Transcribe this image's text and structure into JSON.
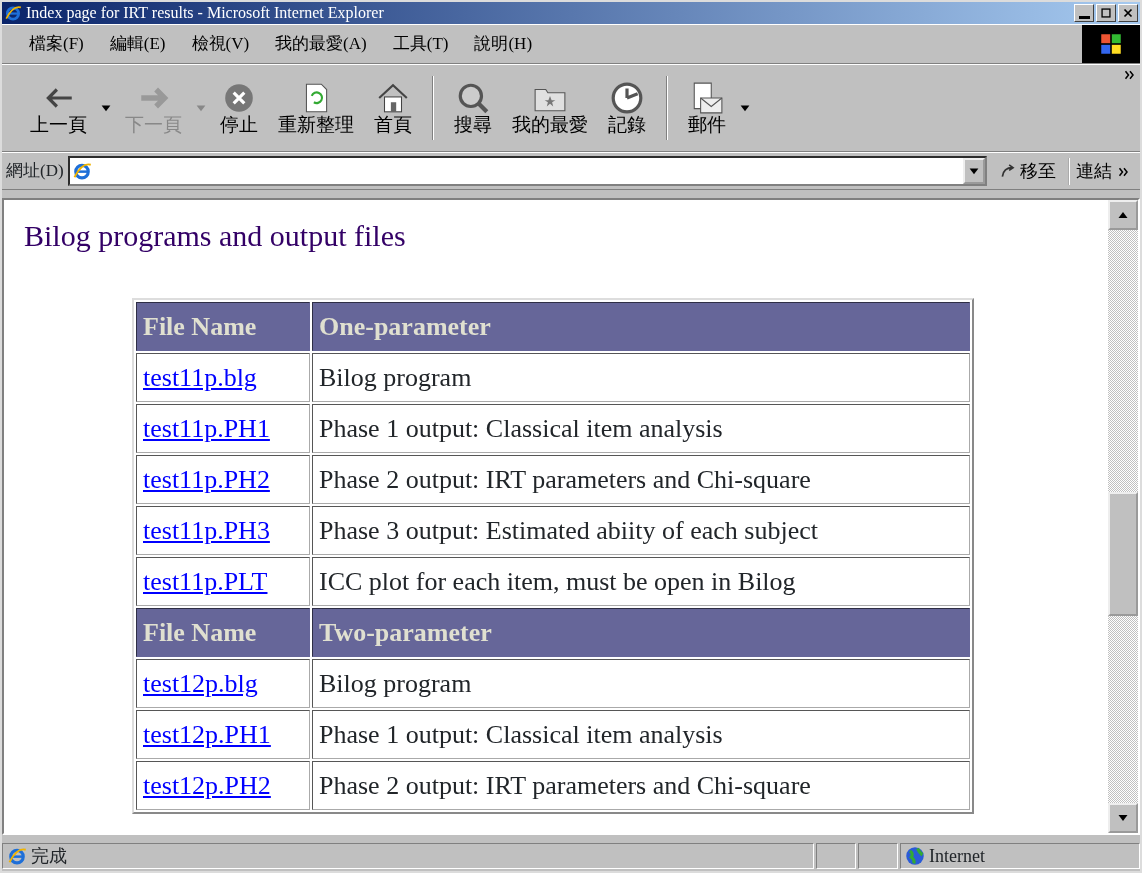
{
  "window": {
    "title": "Index page for IRT results - Microsoft Internet Explorer"
  },
  "menu": [
    {
      "label": "檔案(F)"
    },
    {
      "label": "編輯(E)"
    },
    {
      "label": "檢視(V)"
    },
    {
      "label": "我的最愛(A)"
    },
    {
      "label": "工具(T)"
    },
    {
      "label": "說明(H)"
    }
  ],
  "toolbar": [
    {
      "kind": "back",
      "label": "上一頁",
      "disabled": false,
      "dropdown": true
    },
    {
      "kind": "forward",
      "label": "下一頁",
      "disabled": true,
      "dropdown": true
    },
    {
      "kind": "stop",
      "label": "停止",
      "disabled": false,
      "dropdown": false
    },
    {
      "kind": "refresh",
      "label": "重新整理",
      "disabled": false,
      "dropdown": false
    },
    {
      "kind": "home",
      "label": "首頁",
      "disabled": false,
      "dropdown": false
    },
    {
      "kind": "search",
      "label": "搜尋",
      "disabled": false,
      "dropdown": false
    },
    {
      "kind": "favorites",
      "label": "我的最愛",
      "disabled": false,
      "dropdown": false
    },
    {
      "kind": "history",
      "label": "記錄",
      "disabled": false,
      "dropdown": false
    },
    {
      "kind": "mail",
      "label": "郵件",
      "disabled": false,
      "dropdown": true
    }
  ],
  "address_bar": {
    "label": "網址(D)",
    "go": "移至",
    "links": "連結"
  },
  "page": {
    "heading": "Bilog programs and output files",
    "sections": [
      {
        "columns": [
          "File Name",
          "One-parameter"
        ],
        "rows": [
          {
            "file": "test11p.blg",
            "description": "Bilog program"
          },
          {
            "file": "test11p.PH1",
            "description": "Phase 1 output: Classical item analysis"
          },
          {
            "file": "test11p.PH2",
            "description": "Phase 2 output: IRT parameters and Chi-square"
          },
          {
            "file": "test11p.PH3",
            "description": "Phase 3 output: Estimated abiity of each subject"
          },
          {
            "file": "test11p.PLT",
            "description": "ICC plot for each item, must be open in Bilog"
          }
        ]
      },
      {
        "columns": [
          "File Name",
          "Two-parameter"
        ],
        "rows": [
          {
            "file": "test12p.blg",
            "description": "Bilog program"
          },
          {
            "file": "test12p.PH1",
            "description": "Phase 1 output: Classical item analysis"
          },
          {
            "file": "test12p.PH2",
            "description": "Phase 2 output: IRT parameters and Chi-square"
          }
        ]
      }
    ]
  },
  "status_bar": {
    "text": "完成",
    "zone": "Internet"
  }
}
